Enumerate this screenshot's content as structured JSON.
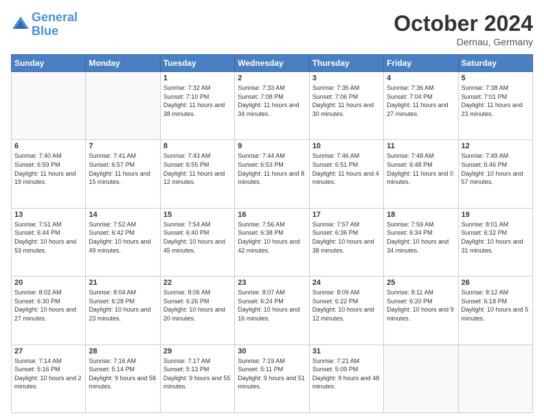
{
  "header": {
    "logo_line1": "General",
    "logo_line2": "Blue",
    "month": "October 2024",
    "location": "Dernau, Germany"
  },
  "days_of_week": [
    "Sunday",
    "Monday",
    "Tuesday",
    "Wednesday",
    "Thursday",
    "Friday",
    "Saturday"
  ],
  "weeks": [
    [
      {
        "day": "",
        "info": ""
      },
      {
        "day": "",
        "info": ""
      },
      {
        "day": "1",
        "info": "Sunrise: 7:32 AM\nSunset: 7:10 PM\nDaylight: 11 hours and 38 minutes."
      },
      {
        "day": "2",
        "info": "Sunrise: 7:33 AM\nSunset: 7:08 PM\nDaylight: 11 hours and 34 minutes."
      },
      {
        "day": "3",
        "info": "Sunrise: 7:35 AM\nSunset: 7:06 PM\nDaylight: 11 hours and 30 minutes."
      },
      {
        "day": "4",
        "info": "Sunrise: 7:36 AM\nSunset: 7:04 PM\nDaylight: 11 hours and 27 minutes."
      },
      {
        "day": "5",
        "info": "Sunrise: 7:38 AM\nSunset: 7:01 PM\nDaylight: 11 hours and 23 minutes."
      }
    ],
    [
      {
        "day": "6",
        "info": "Sunrise: 7:40 AM\nSunset: 6:59 PM\nDaylight: 11 hours and 19 minutes."
      },
      {
        "day": "7",
        "info": "Sunrise: 7:41 AM\nSunset: 6:57 PM\nDaylight: 11 hours and 15 minutes."
      },
      {
        "day": "8",
        "info": "Sunrise: 7:43 AM\nSunset: 6:55 PM\nDaylight: 11 hours and 12 minutes."
      },
      {
        "day": "9",
        "info": "Sunrise: 7:44 AM\nSunset: 6:53 PM\nDaylight: 11 hours and 8 minutes."
      },
      {
        "day": "10",
        "info": "Sunrise: 7:46 AM\nSunset: 6:51 PM\nDaylight: 11 hours and 4 minutes."
      },
      {
        "day": "11",
        "info": "Sunrise: 7:48 AM\nSunset: 6:48 PM\nDaylight: 11 hours and 0 minutes."
      },
      {
        "day": "12",
        "info": "Sunrise: 7:49 AM\nSunset: 6:46 PM\nDaylight: 10 hours and 57 minutes."
      }
    ],
    [
      {
        "day": "13",
        "info": "Sunrise: 7:51 AM\nSunset: 6:44 PM\nDaylight: 10 hours and 53 minutes."
      },
      {
        "day": "14",
        "info": "Sunrise: 7:52 AM\nSunset: 6:42 PM\nDaylight: 10 hours and 49 minutes."
      },
      {
        "day": "15",
        "info": "Sunrise: 7:54 AM\nSunset: 6:40 PM\nDaylight: 10 hours and 45 minutes."
      },
      {
        "day": "16",
        "info": "Sunrise: 7:56 AM\nSunset: 6:38 PM\nDaylight: 10 hours and 42 minutes."
      },
      {
        "day": "17",
        "info": "Sunrise: 7:57 AM\nSunset: 6:36 PM\nDaylight: 10 hours and 38 minutes."
      },
      {
        "day": "18",
        "info": "Sunrise: 7:59 AM\nSunset: 6:34 PM\nDaylight: 10 hours and 34 minutes."
      },
      {
        "day": "19",
        "info": "Sunrise: 8:01 AM\nSunset: 6:32 PM\nDaylight: 10 hours and 31 minutes."
      }
    ],
    [
      {
        "day": "20",
        "info": "Sunrise: 8:02 AM\nSunset: 6:30 PM\nDaylight: 10 hours and 27 minutes."
      },
      {
        "day": "21",
        "info": "Sunrise: 8:04 AM\nSunset: 6:28 PM\nDaylight: 10 hours and 23 minutes."
      },
      {
        "day": "22",
        "info": "Sunrise: 8:06 AM\nSunset: 6:26 PM\nDaylight: 10 hours and 20 minutes."
      },
      {
        "day": "23",
        "info": "Sunrise: 8:07 AM\nSunset: 6:24 PM\nDaylight: 10 hours and 16 minutes."
      },
      {
        "day": "24",
        "info": "Sunrise: 8:09 AM\nSunset: 6:22 PM\nDaylight: 10 hours and 12 minutes."
      },
      {
        "day": "25",
        "info": "Sunrise: 8:11 AM\nSunset: 6:20 PM\nDaylight: 10 hours and 9 minutes."
      },
      {
        "day": "26",
        "info": "Sunrise: 8:12 AM\nSunset: 6:18 PM\nDaylight: 10 hours and 5 minutes."
      }
    ],
    [
      {
        "day": "27",
        "info": "Sunrise: 7:14 AM\nSunset: 5:16 PM\nDaylight: 10 hours and 2 minutes."
      },
      {
        "day": "28",
        "info": "Sunrise: 7:16 AM\nSunset: 5:14 PM\nDaylight: 9 hours and 58 minutes."
      },
      {
        "day": "29",
        "info": "Sunrise: 7:17 AM\nSunset: 5:13 PM\nDaylight: 9 hours and 55 minutes."
      },
      {
        "day": "30",
        "info": "Sunrise: 7:19 AM\nSunset: 5:11 PM\nDaylight: 9 hours and 51 minutes."
      },
      {
        "day": "31",
        "info": "Sunrise: 7:21 AM\nSunset: 5:09 PM\nDaylight: 9 hours and 48 minutes."
      },
      {
        "day": "",
        "info": ""
      },
      {
        "day": "",
        "info": ""
      }
    ]
  ]
}
